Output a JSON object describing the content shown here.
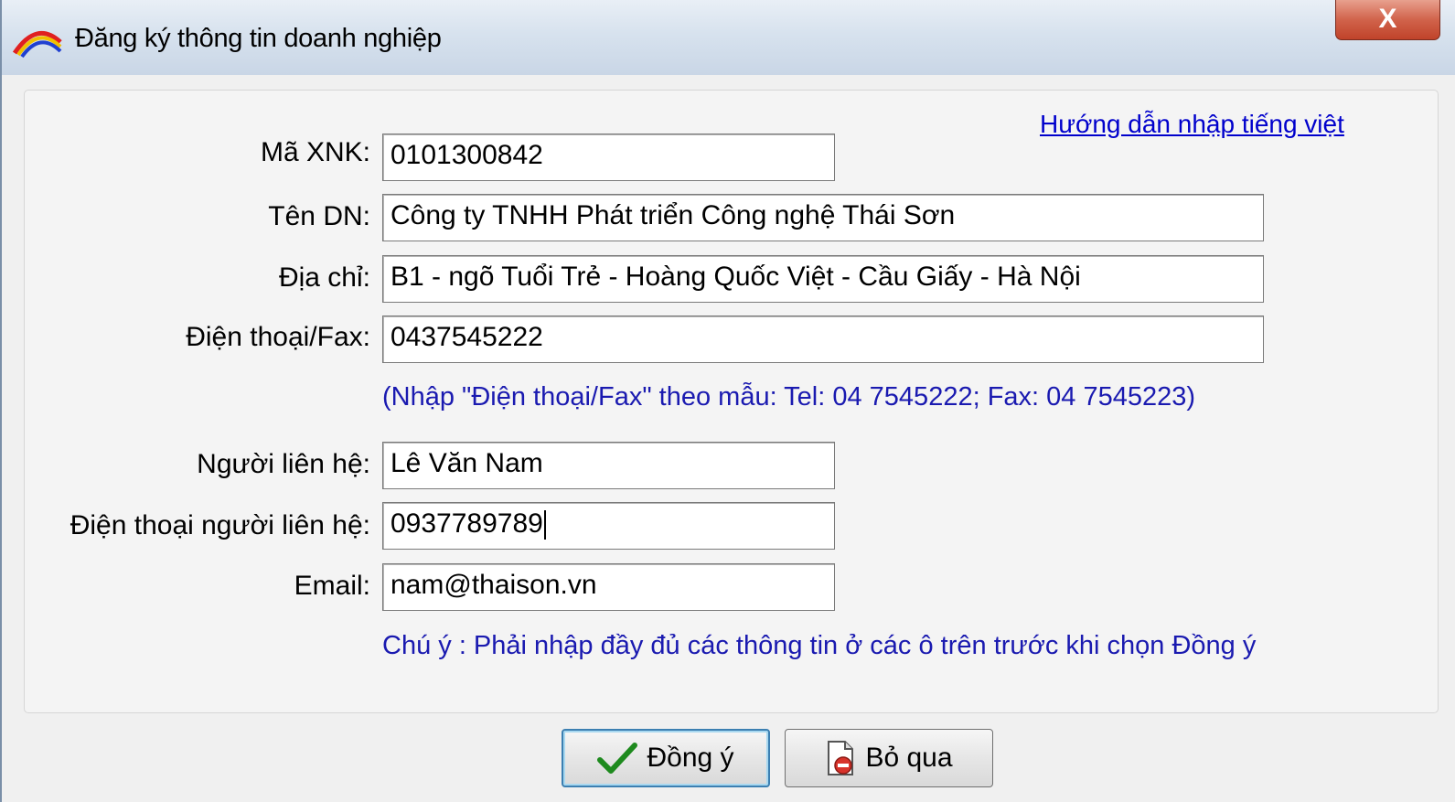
{
  "window": {
    "title": "Đăng ký thông tin doanh nghiệp",
    "close_label": "X"
  },
  "help_link": "Hướng dẫn nhập tiếng việt",
  "form": {
    "ma_xnk": {
      "label": "Mã XNK:",
      "value": "0101300842"
    },
    "ten_dn": {
      "label": "Tên DN:",
      "value": "Công ty TNHH Phát triển Công nghệ Thái Sơn"
    },
    "dia_chi": {
      "label": "Địa chỉ:",
      "value": "B1 - ngõ Tuổi Trẻ - Hoàng Quốc Việt - Cầu Giấy - Hà Nội"
    },
    "dien_thoai_fax": {
      "label": "Điện thoại/Fax:",
      "value": "0437545222"
    },
    "phone_hint": "(Nhập \"Điện thoại/Fax\" theo mẫu: Tel: 04 7545222; Fax: 04 7545223)",
    "nguoi_lien_he": {
      "label": "Người liên hệ:",
      "value": "Lê Văn Nam"
    },
    "dien_thoai_nguoi_lien_he": {
      "label": "Điện thoại người liên hệ:",
      "value": "0937789789"
    },
    "email": {
      "label": "Email:",
      "value": "nam@thaison.vn"
    },
    "note": "Chú ý : Phải nhập đầy đủ các thông tin ở các ô trên trước khi chọn Đồng ý"
  },
  "buttons": {
    "ok_label": "Đồng ý",
    "cancel_label": "Bỏ qua"
  },
  "icons": {
    "app": "rainbow-arc-icon",
    "ok": "checkmark-icon",
    "cancel": "document-cancel-icon"
  },
  "colors": {
    "hint_text": "#1a1ab0",
    "link": "#0000cc",
    "close_button": "#c0432a"
  }
}
